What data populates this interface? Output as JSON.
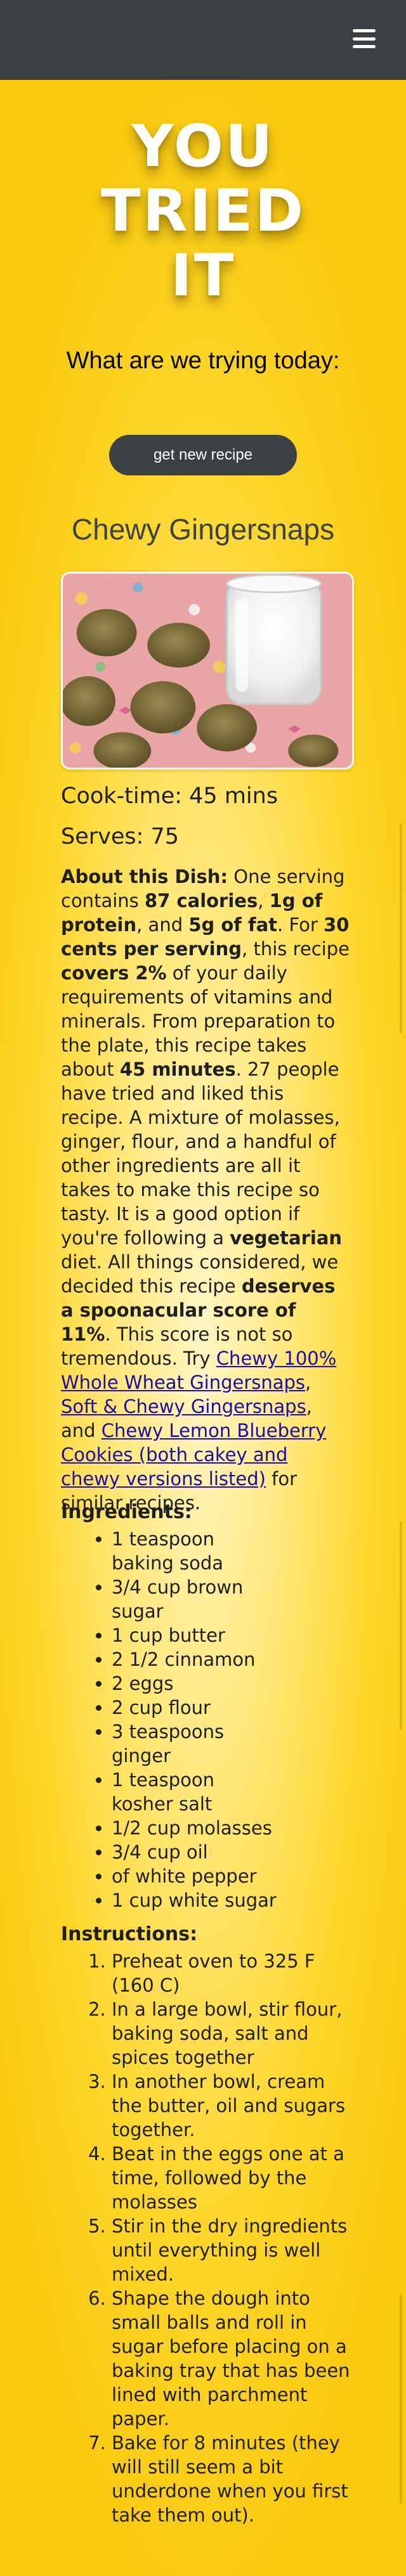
{
  "navbar": {
    "menu_icon": "hamburger-menu-icon"
  },
  "hero": {
    "title_lines": [
      "YOU",
      "TRIED",
      "IT"
    ],
    "subtitle": "What are we trying today:",
    "button_label": "get new recipe"
  },
  "recipe": {
    "title": "Chewy Gingersnaps",
    "cook_time": "Cook-time: 45 mins",
    "serves": "Serves: 75",
    "about": {
      "label": "About this Dish:",
      "t1": " One serving contains ",
      "b1": "87 calories",
      "t2": ", ",
      "b2": "1g of protein",
      "t3": ", and ",
      "b3": "5g of fat",
      "t4": ". For ",
      "b4": "30 cents per serving",
      "t5": ", this recipe ",
      "b5": "covers 2%",
      "t6": " of your daily requirements of vitamins and minerals. From preparation to the plate, this recipe takes about ",
      "b6": "45 minutes",
      "t7": ". 27 people have tried and liked this recipe. A mixture of molasses, ginger, flour, and a handful of other ingredients are all it takes to make this recipe so tasty. It is a good option if you're following a ",
      "b7": "vegetarian",
      "t8": " diet. All things considered, we decided this recipe ",
      "b8": "deserves a spoonacular score of 11%",
      "t9": ". This score is not so tremendous. Try ",
      "link1": "Chewy 100% Whole Wheat Gingersnaps",
      "t10": ", ",
      "link2": "Soft & Chewy Gingersnaps",
      "t11": ", and ",
      "link3": "Chewy Lemon Blueberry Cookies (both cakey and chewy versions listed)",
      "t12": " for similar recipes."
    },
    "ingredients_heading": "Ingredients:",
    "ingredients": [
      "1 teaspoon baking soda",
      "3/4 cup brown sugar",
      "1 cup butter",
      "2 1/2 cinnamon",
      "2 eggs",
      "2 cup flour",
      "3 teaspoons ginger",
      "1 teaspoon kosher salt",
      "1/2 cup molasses",
      "3/4 cup oil",
      "of white pepper",
      "1 cup white sugar"
    ],
    "instructions_heading": "Instructions:",
    "instructions": [
      "Preheat oven to 325 F (160 C)",
      "In a large bowl, stir flour, baking soda, salt and spices together",
      "In another bowl, cream the butter, oil and sugars together.",
      "Beat in the eggs one at a time, followed by the molasses",
      "Stir in the dry ingredients until everything is well mixed.",
      "Shape the dough into small balls and roll in sugar before placing on a baking tray that has been lined with parchment paper.",
      "Bake for 8 minutes (they will still seem a bit underdone when you first take them out)."
    ]
  },
  "colors": {
    "navbar": "#3d4043",
    "background": "#fdd628",
    "button": "#3d4043",
    "link": "#1a0dab"
  }
}
